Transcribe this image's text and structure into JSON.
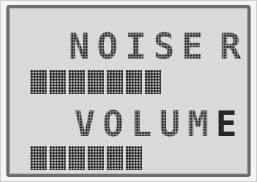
{
  "display": {
    "title": "NOISE",
    "channel": "R",
    "label": "VOLUME",
    "noise_level": 7,
    "volume_level": 6
  },
  "colors": {
    "background": "#d9d9d9",
    "segment": "#262626",
    "bezel": "#6d6d6d"
  }
}
